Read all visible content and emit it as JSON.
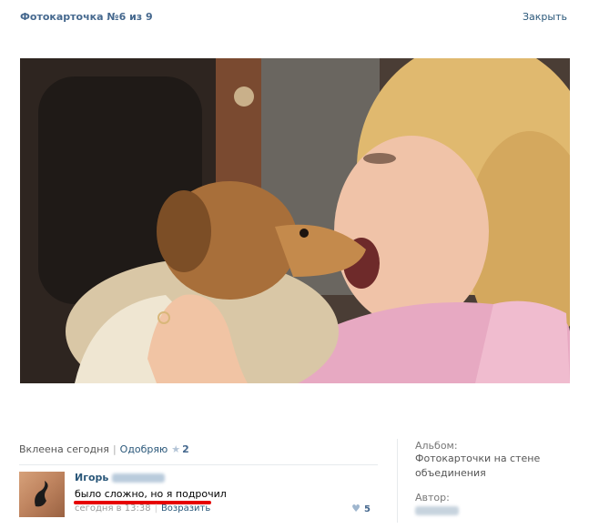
{
  "header": {
    "title": "Фотокарточка №6 из 9",
    "close_label": "Закрыть"
  },
  "photo": {
    "description_icon": "photo-image"
  },
  "meta": {
    "added": "Вклеена сегодня",
    "like_label": "Одобряю",
    "like_count": "2"
  },
  "comment": {
    "author_first": "Игорь",
    "text": "было сложно, но я подрочил",
    "time": "сегодня в 13:38",
    "reply_label": "Возразить",
    "likes": "5"
  },
  "sidebar": {
    "album_label": "Альбом:",
    "album_value": "Фотокарточки на стене объединения",
    "author_label": "Автор:"
  },
  "colors": {
    "link": "#2b587a",
    "title": "#45688e",
    "underline": "#e60000"
  }
}
